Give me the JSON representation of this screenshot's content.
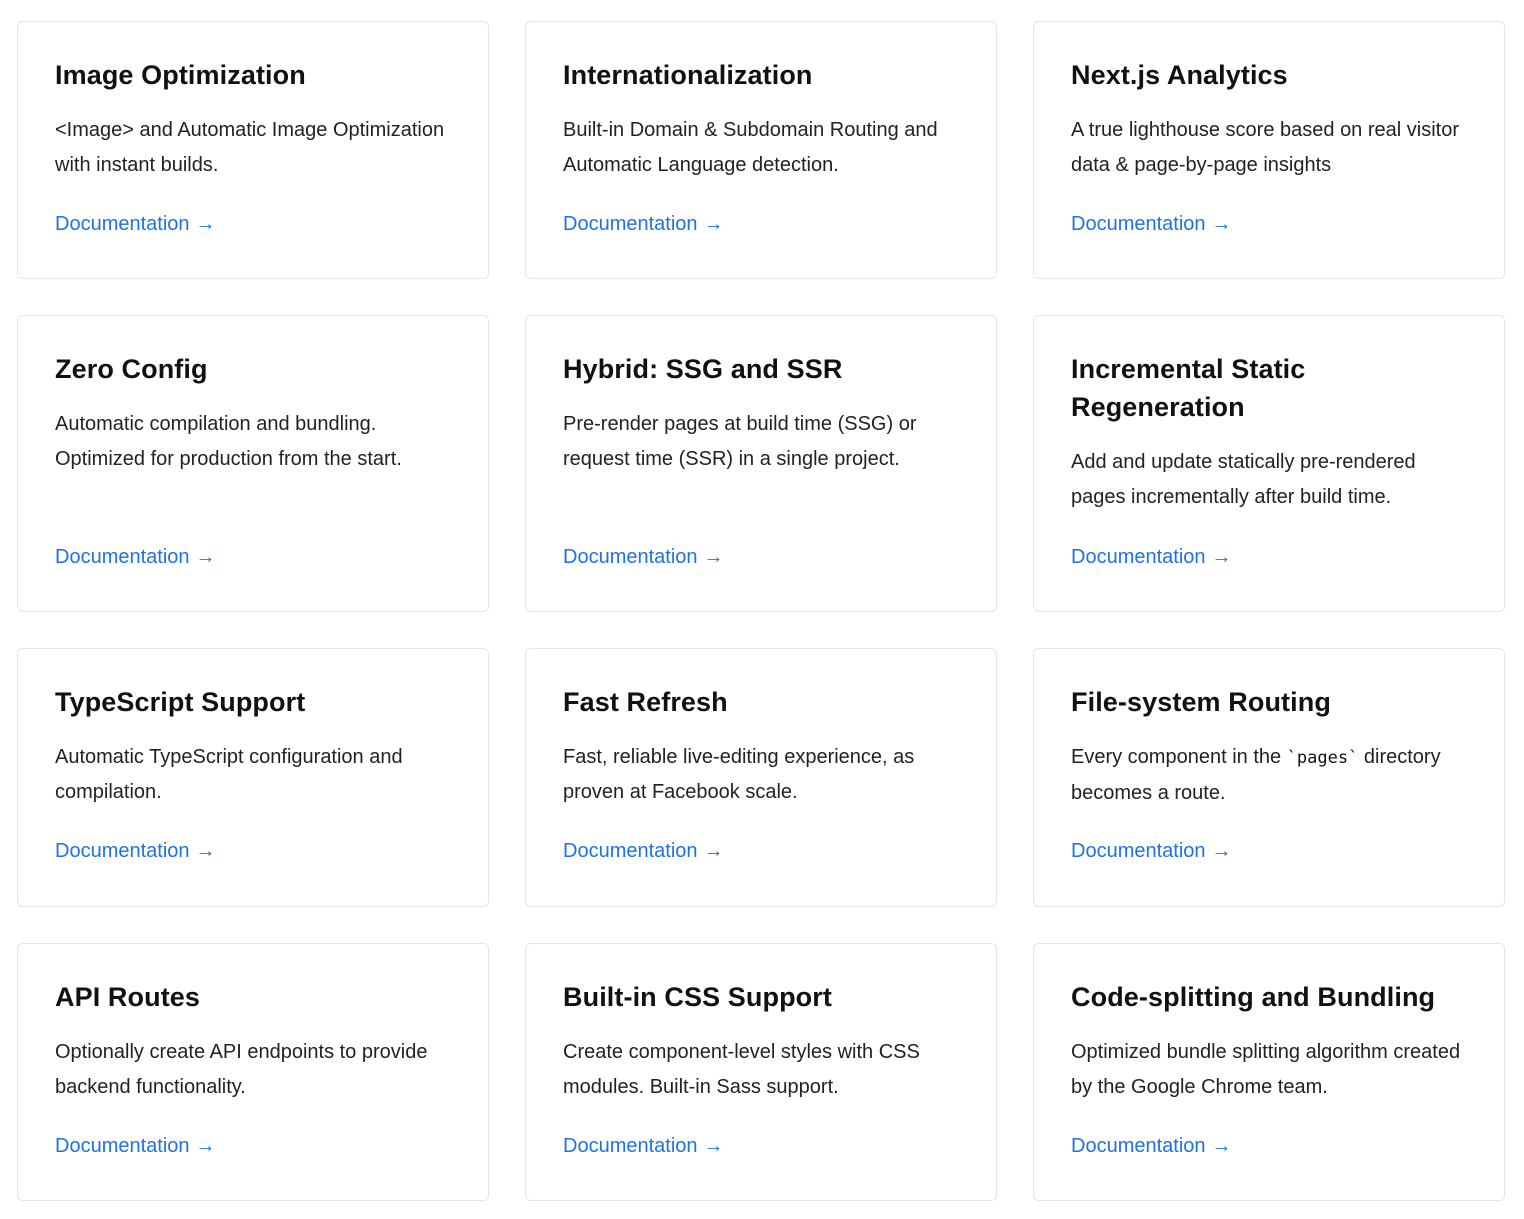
{
  "link_color": "#1e73e0",
  "cards": [
    {
      "title": "Image Optimization",
      "description": "<Image> and Automatic Image Optimization with instant builds.",
      "link": "Documentation",
      "arrow": "→"
    },
    {
      "title": "Internationalization",
      "description": "Built-in Domain & Subdomain Routing and Automatic Language detection.",
      "link": "Documentation",
      "arrow": "→"
    },
    {
      "title": "Next.js Analytics",
      "description": "A true lighthouse score based on real visitor data & page-by-page insights",
      "link": "Documentation",
      "arrow": "→"
    },
    {
      "title": "Zero Config",
      "description": "Automatic compilation and bundling. Optimized for production from the start.",
      "link": "Documentation",
      "arrow": "→"
    },
    {
      "title": "Hybrid: SSG and SSR",
      "description": "Pre-render pages at build time (SSG) or request time (SSR) in a single project.",
      "link": "Documentation",
      "arrow": "→"
    },
    {
      "title": "Incremental Static Regeneration",
      "description": "Add and update statically pre-rendered pages incrementally after build time.",
      "link": "Documentation",
      "arrow": "→"
    },
    {
      "title": "TypeScript Support",
      "description": "Automatic TypeScript configuration and compilation.",
      "link": "Documentation",
      "arrow": "→"
    },
    {
      "title": "Fast Refresh",
      "description": "Fast, reliable live-editing experience, as proven at Facebook scale.",
      "link": "Documentation",
      "arrow": "→"
    },
    {
      "title": "File-system Routing",
      "description_before": "Every component in the ",
      "description_code": "`pages`",
      "description_after": " directory becomes a route.",
      "link": "Documentation",
      "arrow": "→"
    },
    {
      "title": "API Routes",
      "description": "Optionally create API endpoints to provide backend functionality.",
      "link": "Documentation",
      "arrow": "→"
    },
    {
      "title": "Built-in CSS Support",
      "description": "Create component-level styles with CSS modules. Built-in Sass support.",
      "link": "Documentation",
      "arrow": "→"
    },
    {
      "title": "Code-splitting and Bundling",
      "description": "Optimized bundle splitting algorithm created by the Google Chrome team.",
      "link": "Documentation",
      "arrow": "→"
    }
  ]
}
